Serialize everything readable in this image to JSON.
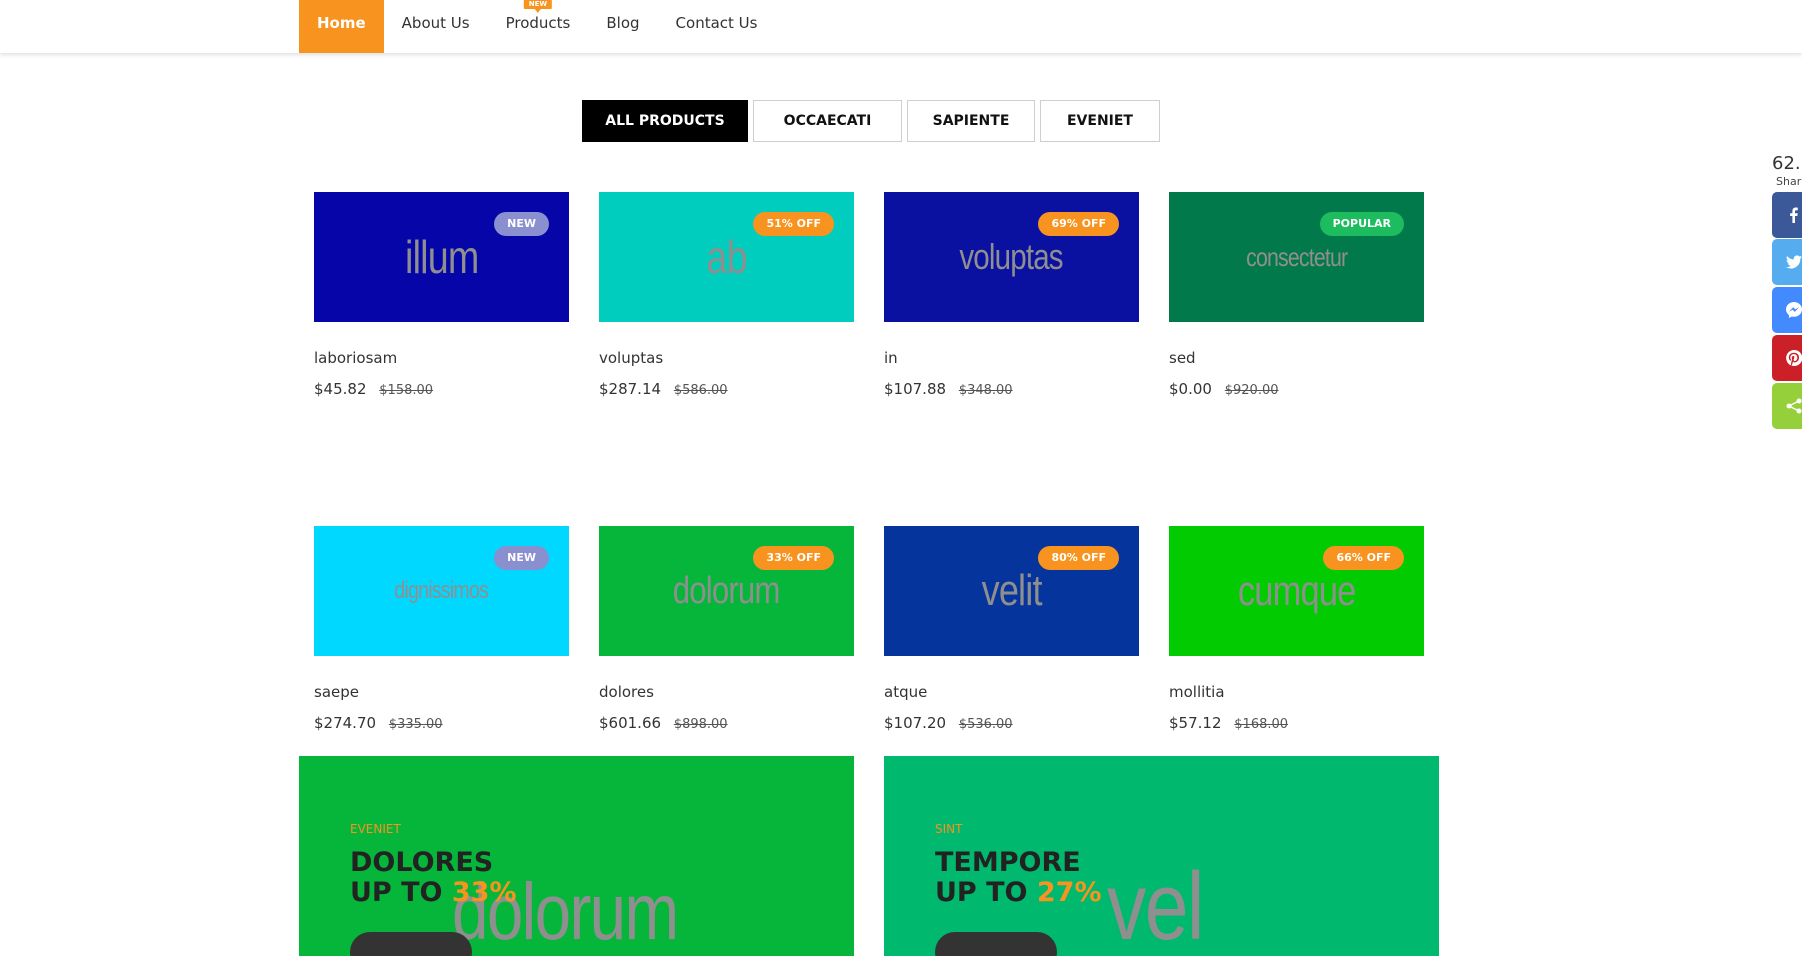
{
  "nav": {
    "items": [
      {
        "label": "Home",
        "active": true
      },
      {
        "label": "About Us",
        "active": false
      },
      {
        "label": "Products",
        "active": false,
        "badge": "NEW"
      },
      {
        "label": "Blog",
        "active": false
      },
      {
        "label": "Contact Us",
        "active": false
      }
    ],
    "accent": "#f7931e"
  },
  "filters": [
    {
      "label": "ALL PRODUCTS",
      "active": true
    },
    {
      "label": "OCCAECATI",
      "active": false
    },
    {
      "label": "SAPIENTE",
      "active": false
    },
    {
      "label": "EVENIET",
      "active": false
    }
  ],
  "products": [
    {
      "image_text": "illum",
      "bg": "#0505a8",
      "badge": "NEW",
      "badge_color": "#8a8fd0",
      "name": "laboriosam",
      "price": "$45.82",
      "old_price": "$158.00"
    },
    {
      "image_text": "ab",
      "bg": "#00cdbd",
      "badge": "51% OFF",
      "badge_color": "#f7931e",
      "name": "voluptas",
      "price": "$287.14",
      "old_price": "$586.00"
    },
    {
      "image_text": "voluptas",
      "bg": "#0a10a0",
      "badge": "69% OFF",
      "badge_color": "#f7931e",
      "name": "in",
      "price": "$107.88",
      "old_price": "$348.00"
    },
    {
      "image_text": "consectetur",
      "bg": "#01794a",
      "badge": "POPULAR",
      "badge_color": "#1dbd5f",
      "name": "sed",
      "price": "$0.00",
      "old_price": "$920.00"
    },
    {
      "image_text": "dignissimos",
      "bg": "#00d8ff",
      "badge": "NEW",
      "badge_color": "#8a8fd0",
      "name": "saepe",
      "price": "$274.70",
      "old_price": "$335.00"
    },
    {
      "image_text": "dolorum",
      "bg": "#06b63b",
      "badge": "33% OFF",
      "badge_color": "#f7931e",
      "name": "dolores",
      "price": "$601.66",
      "old_price": "$898.00"
    },
    {
      "image_text": "velit",
      "bg": "#05349c",
      "badge": "80% OFF",
      "badge_color": "#f7931e",
      "name": "atque",
      "price": "$107.20",
      "old_price": "$536.00"
    },
    {
      "image_text": "cumque",
      "bg": "#03cb02",
      "badge": "66% OFF",
      "badge_color": "#f7931e",
      "name": "mollitia",
      "price": "$57.12",
      "old_price": "$168.00"
    }
  ],
  "banners": [
    {
      "tag": "EVENIET",
      "title_line1": "DOLORES",
      "title_line2_prefix": "UP TO",
      "percent": "33%",
      "bg_text": "dolorum",
      "bg": "#06b63b"
    },
    {
      "tag": "SINT",
      "title_line1": "TEMPORE",
      "title_line2_prefix": "UP TO",
      "percent": "27%",
      "bg_text": "vel",
      "bg": "#00b86e"
    }
  ],
  "share": {
    "count": "62.",
    "label": "Shar",
    "buttons": [
      {
        "icon": "facebook-icon",
        "color": "#3b5998"
      },
      {
        "icon": "twitter-icon",
        "color": "#55acee"
      },
      {
        "icon": "messenger-icon",
        "color": "#448aff"
      },
      {
        "icon": "pinterest-icon",
        "color": "#cb2027"
      },
      {
        "icon": "share-icon",
        "color": "#95d03a"
      }
    ]
  }
}
